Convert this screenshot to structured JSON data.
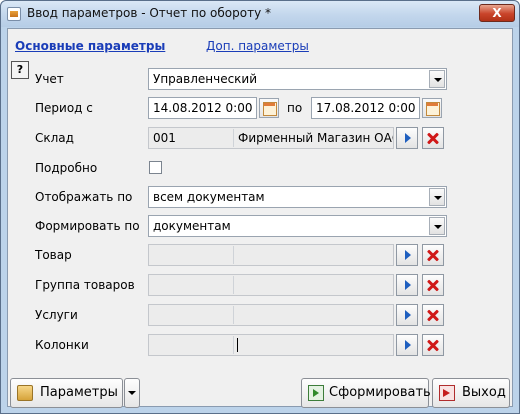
{
  "window": {
    "title": "Ввод параметров - Отчет по обороту *",
    "close_label": "X"
  },
  "tabs": [
    {
      "label": "Основные параметры",
      "active": true
    },
    {
      "label": "Доп. параметры",
      "active": false
    }
  ],
  "help_button": "?",
  "form": {
    "uchet": {
      "label": "Учет",
      "value": "Управленческий"
    },
    "period": {
      "label": "Период с",
      "from": "14.08.2012 0:00",
      "to_label": "по",
      "to": "17.08.2012 0:00"
    },
    "sklad": {
      "label": "Склад",
      "code": "001",
      "name": "Фирменный Магазин ОАО"
    },
    "podrobno": {
      "label": "Подробно",
      "checked": false
    },
    "otobrazhat": {
      "label": "Отображать по",
      "value": "всем документам"
    },
    "formirovat": {
      "label": "Формировать по",
      "value": "документам"
    },
    "tovar": {
      "label": "Товар",
      "code": "",
      "name": ""
    },
    "gruppa": {
      "label": "Группа товаров",
      "code": "",
      "name": ""
    },
    "uslugi": {
      "label": "Услуги",
      "code": "",
      "name": ""
    },
    "kolonki": {
      "label": "Колонки",
      "code": "",
      "name": ""
    }
  },
  "buttons": {
    "params": "Параметры",
    "form": "Сформировать",
    "exit": "Выход"
  },
  "icons": {
    "select": "select-arrow-icon",
    "clear": "clear-x-icon",
    "calendar": "calendar-icon"
  }
}
